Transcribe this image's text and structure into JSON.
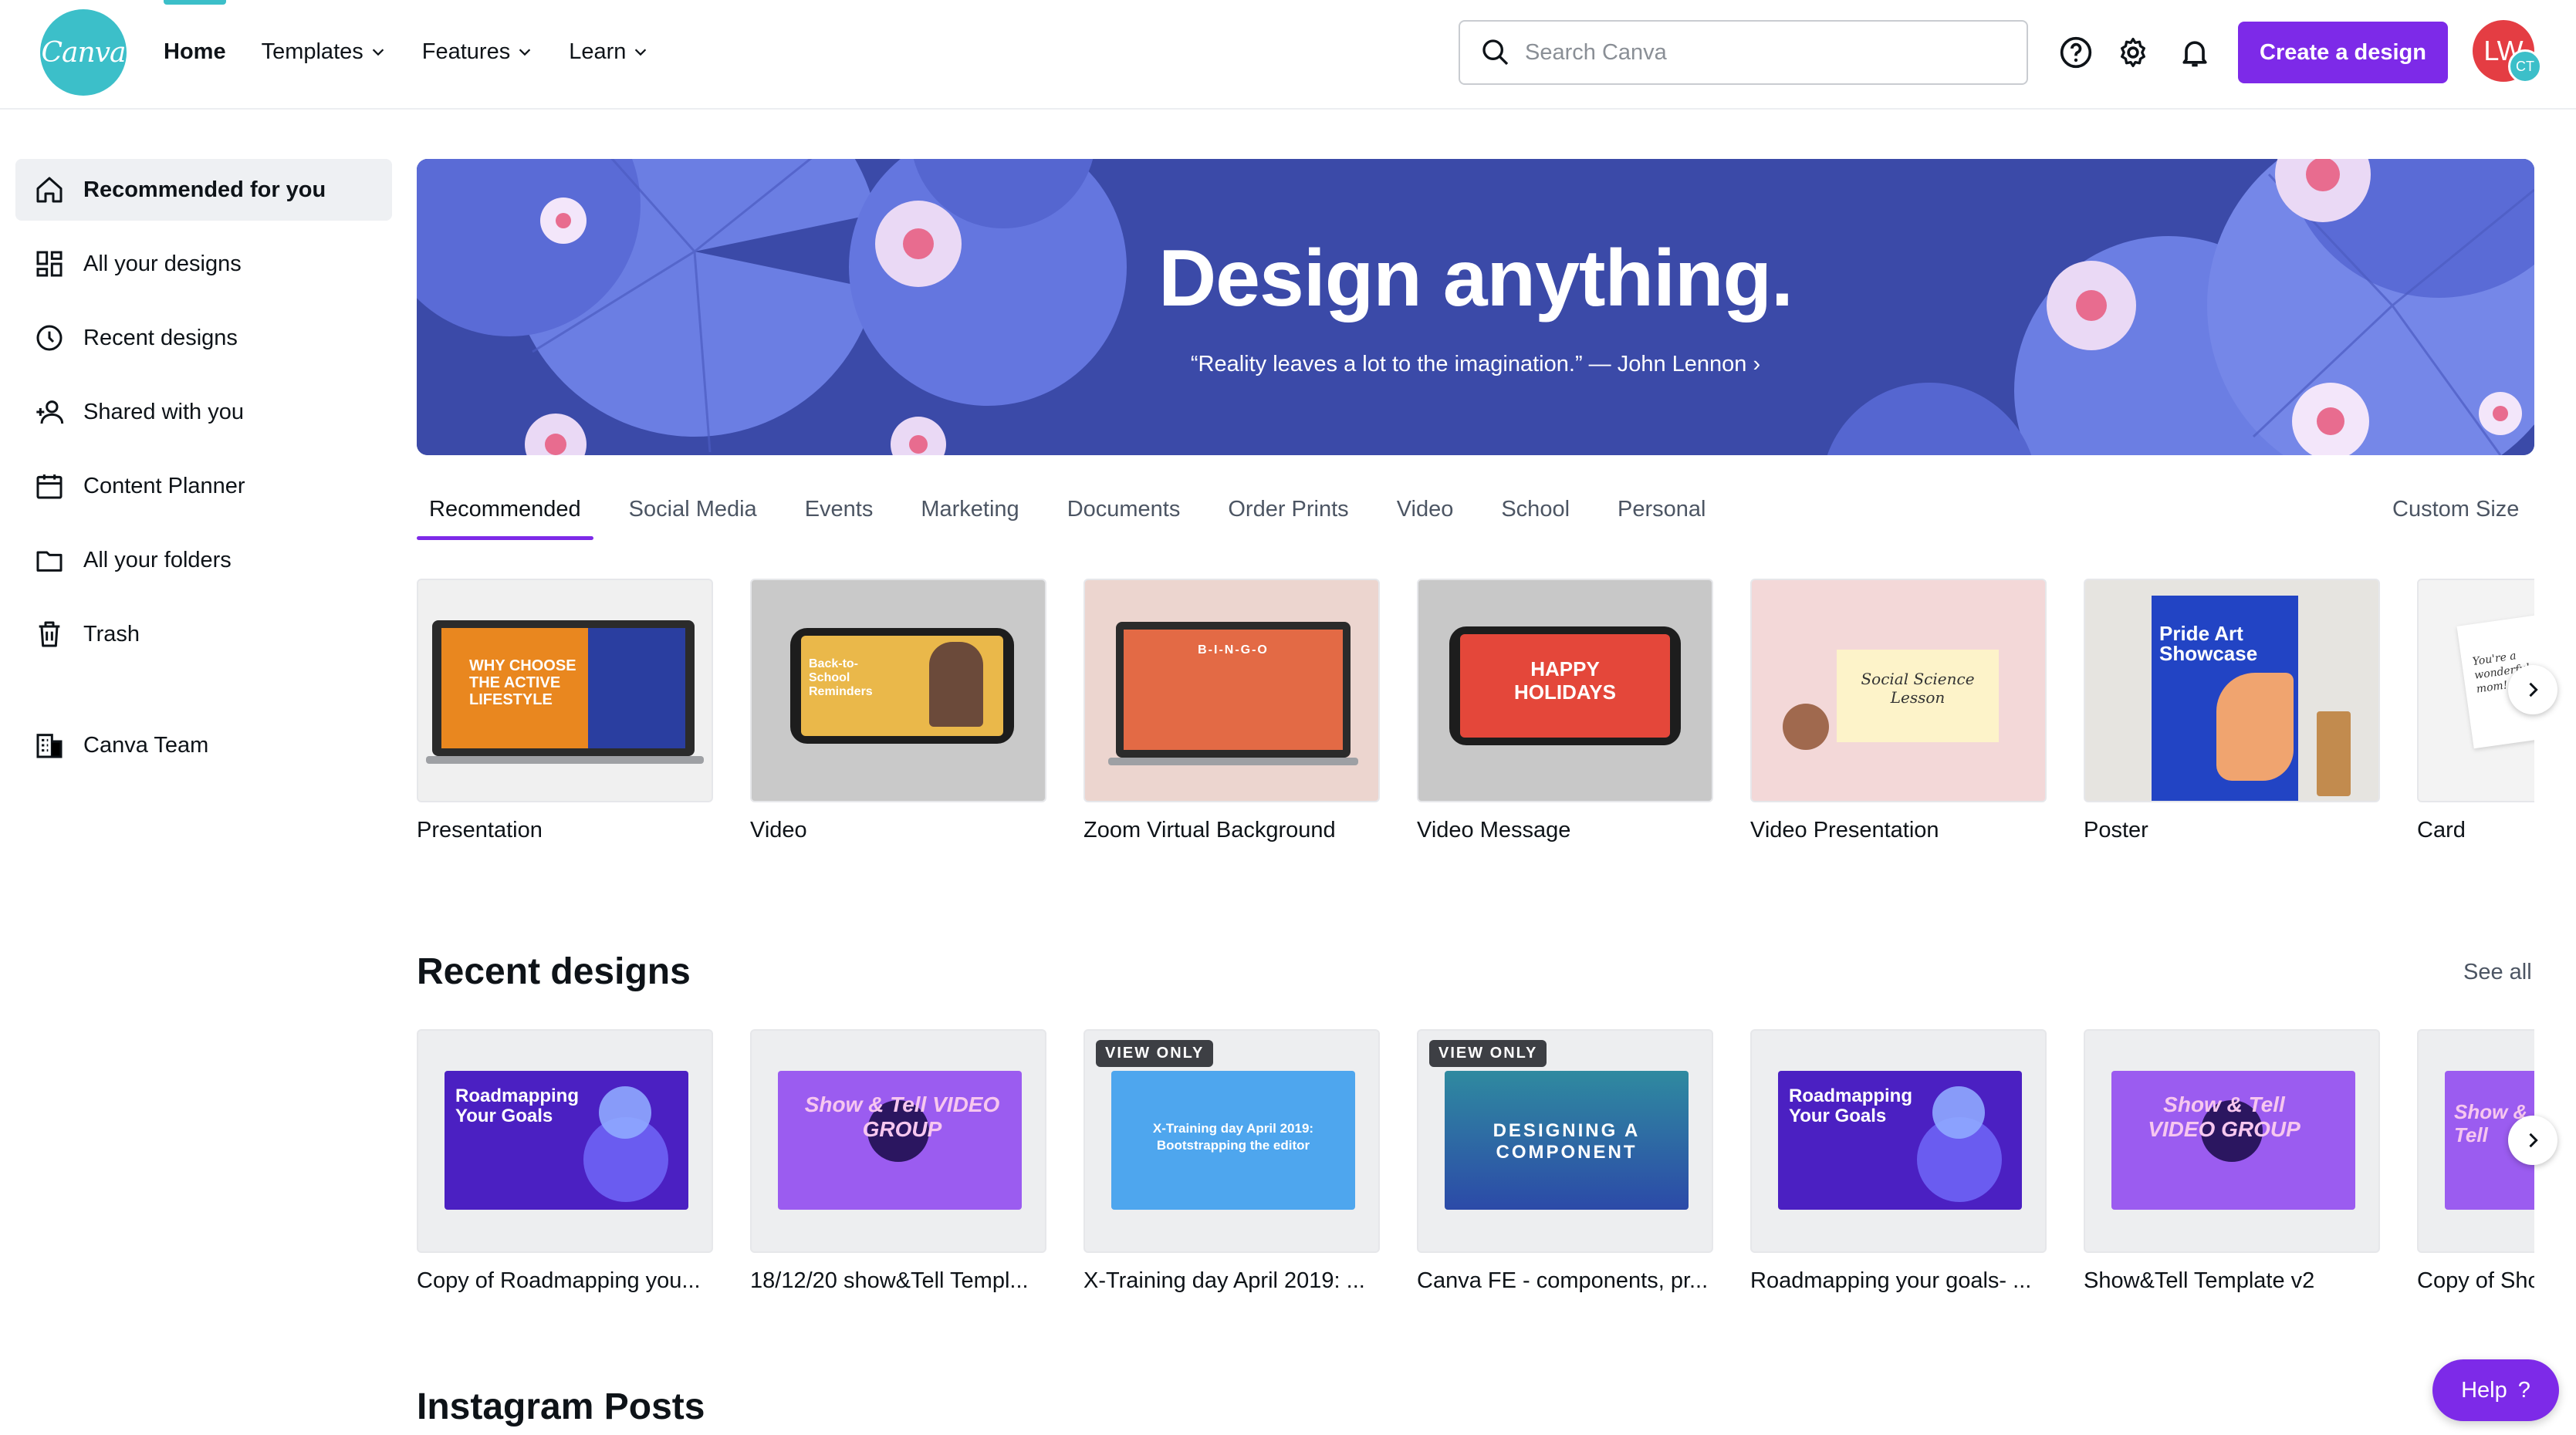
{
  "header": {
    "logo_text": "Canva",
    "nav": [
      {
        "label": "Home",
        "active": true,
        "dropdown": false
      },
      {
        "label": "Templates",
        "active": false,
        "dropdown": true
      },
      {
        "label": "Features",
        "active": false,
        "dropdown": true
      },
      {
        "label": "Learn",
        "active": false,
        "dropdown": true
      }
    ],
    "search_placeholder": "Search Canva",
    "create_label": "Create a design",
    "avatar_initials": "LW",
    "avatar_team_initials": "CT"
  },
  "sidebar": {
    "items": [
      {
        "label": "Recommended for you",
        "icon": "home-icon",
        "active": true
      },
      {
        "label": "All your designs",
        "icon": "grid-icon",
        "active": false
      },
      {
        "label": "Recent designs",
        "icon": "clock-icon",
        "active": false
      },
      {
        "label": "Shared with you",
        "icon": "users-icon",
        "active": false
      },
      {
        "label": "Content Planner",
        "icon": "calendar-icon",
        "active": false
      },
      {
        "label": "All your folders",
        "icon": "folder-icon",
        "active": false
      },
      {
        "label": "Trash",
        "icon": "trash-icon",
        "active": false
      }
    ],
    "team": {
      "label": "Canva Team",
      "icon": "team-icon"
    }
  },
  "hero": {
    "title": "Design anything.",
    "quote": "“Reality leaves a lot to the imagination.” — John Lennon ›"
  },
  "tabs": [
    "Recommended",
    "Social Media",
    "Events",
    "Marketing",
    "Documents",
    "Order Prints",
    "Video",
    "School",
    "Personal"
  ],
  "custom_size": "Custom Size",
  "templates": [
    {
      "label": "Presentation",
      "thumb_text": "WHY CHOOSE THE ACTIVE LIFESTYLE"
    },
    {
      "label": "Video",
      "thumb_text": "Back-to-School Reminders"
    },
    {
      "label": "Zoom Virtual Background",
      "thumb_text": "B-I-N-G-O"
    },
    {
      "label": "Video Message",
      "thumb_text": "HAPPY HOLIDAYS"
    },
    {
      "label": "Video Presentation",
      "thumb_text": "Social Science Lesson"
    },
    {
      "label": "Poster",
      "thumb_text": "Pride Art Showcase"
    },
    {
      "label": "Card",
      "thumb_text": "You're a wonderful mom!"
    }
  ],
  "recent": {
    "title": "Recent designs",
    "see_all": "See all",
    "items": [
      {
        "label": "Copy of Roadmapping you...",
        "thumb_text": "Roadmapping Your Goals",
        "badge": ""
      },
      {
        "label": "18/12/20 show&Tell Templ...",
        "thumb_text": "Show & Tell VIDEO GROUP",
        "badge": ""
      },
      {
        "label": "X-Training day April 2019: ...",
        "thumb_text": "X-Training day April 2019: Bootstrapping the editor",
        "badge": "VIEW ONLY"
      },
      {
        "label": "Canva FE - components, pr...",
        "thumb_text": "DESIGNING A COMPONENT",
        "badge": "VIEW ONLY"
      },
      {
        "label": "Roadmapping your goals- ...",
        "thumb_text": "Roadmapping Your Goals",
        "badge": ""
      },
      {
        "label": "Show&Tell Template v2",
        "thumb_text": "Show & Tell VIDEO GROUP",
        "badge": ""
      },
      {
        "label": "Copy of Sho",
        "thumb_text": "Show & Tell",
        "badge": ""
      }
    ]
  },
  "instagram_title": "Instagram Posts",
  "help_label": "Help",
  "help_icon": "?",
  "colors": {
    "brand_teal": "#3cbfc9",
    "brand_purple": "#7d2ae8",
    "hero_bg": "#3b4aa8"
  }
}
